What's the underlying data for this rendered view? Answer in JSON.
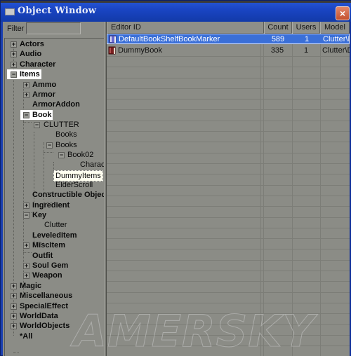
{
  "window": {
    "title": "Object Window",
    "close_label": "×"
  },
  "filter": {
    "label": "Filter",
    "value": "",
    "placeholder": ""
  },
  "tree": {
    "nodes": [
      {
        "label": "Actors",
        "expander": "+"
      },
      {
        "label": "Audio",
        "expander": "+"
      },
      {
        "label": "Character",
        "expander": "+"
      },
      {
        "label": "Items",
        "expander": "−"
      },
      {
        "label": "Ammo",
        "expander": "+"
      },
      {
        "label": "Armor",
        "expander": "+"
      },
      {
        "label": "ArmorAddon",
        "expander": ""
      },
      {
        "label": "Book",
        "expander": "−"
      },
      {
        "label": "CLUTTER",
        "expander": "−"
      },
      {
        "label": "Books",
        "expander": ""
      },
      {
        "label": "Books",
        "expander": "−"
      },
      {
        "label": "Book02",
        "expander": "−"
      },
      {
        "label": "Charact",
        "expander": ""
      },
      {
        "label": "DummyItems",
        "expander": ""
      },
      {
        "label": "ElderScroll",
        "expander": ""
      },
      {
        "label": "Constructible Objec",
        "expander": ""
      },
      {
        "label": "Ingredient",
        "expander": "+"
      },
      {
        "label": "Key",
        "expander": "−"
      },
      {
        "label": "Clutter",
        "expander": ""
      },
      {
        "label": "LeveledItem",
        "expander": ""
      },
      {
        "label": "MiscItem",
        "expander": "+"
      },
      {
        "label": "Outfit",
        "expander": ""
      },
      {
        "label": "Soul Gem",
        "expander": "+"
      },
      {
        "label": "Weapon",
        "expander": "+"
      },
      {
        "label": "Magic",
        "expander": "+"
      },
      {
        "label": "Miscellaneous",
        "expander": "+"
      },
      {
        "label": "SpecialEffect",
        "expander": "+"
      },
      {
        "label": "WorldData",
        "expander": "+"
      },
      {
        "label": "WorldObjects",
        "expander": "+"
      },
      {
        "label": "*All",
        "expander": ""
      }
    ]
  },
  "list": {
    "columns": [
      "Editor ID",
      "Count",
      "Users",
      "Model"
    ],
    "rows": [
      {
        "icon": "book-blue-icon",
        "editor_id": "DefaultBookShelfBookMarker",
        "count": "589",
        "users": "1",
        "model": "Clutter\\D",
        "selected": true
      },
      {
        "icon": "book-red-icon",
        "editor_id": "DummyBook",
        "count": "335",
        "users": "1",
        "model": "Clutter\\D",
        "selected": false
      }
    ]
  },
  "watermark": "AMERSKY"
}
